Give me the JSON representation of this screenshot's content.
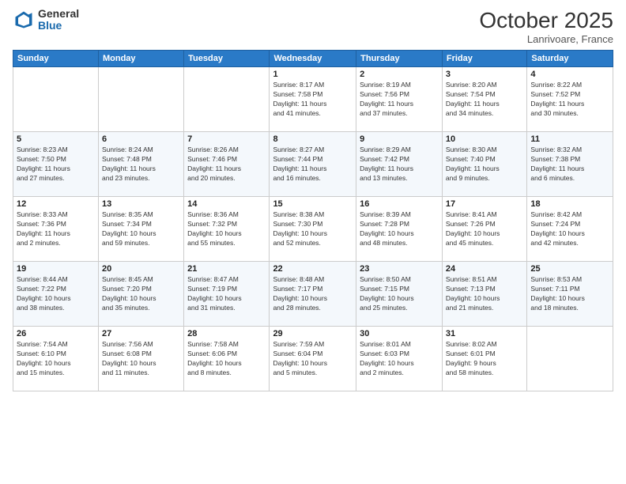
{
  "header": {
    "logo": {
      "general": "General",
      "blue": "Blue"
    },
    "title": "October 2025",
    "location": "Lanrivoare, France"
  },
  "weekdays": [
    "Sunday",
    "Monday",
    "Tuesday",
    "Wednesday",
    "Thursday",
    "Friday",
    "Saturday"
  ],
  "weeks": [
    [
      {
        "day": "",
        "info": ""
      },
      {
        "day": "",
        "info": ""
      },
      {
        "day": "",
        "info": ""
      },
      {
        "day": "1",
        "info": "Sunrise: 8:17 AM\nSunset: 7:58 PM\nDaylight: 11 hours\nand 41 minutes."
      },
      {
        "day": "2",
        "info": "Sunrise: 8:19 AM\nSunset: 7:56 PM\nDaylight: 11 hours\nand 37 minutes."
      },
      {
        "day": "3",
        "info": "Sunrise: 8:20 AM\nSunset: 7:54 PM\nDaylight: 11 hours\nand 34 minutes."
      },
      {
        "day": "4",
        "info": "Sunrise: 8:22 AM\nSunset: 7:52 PM\nDaylight: 11 hours\nand 30 minutes."
      }
    ],
    [
      {
        "day": "5",
        "info": "Sunrise: 8:23 AM\nSunset: 7:50 PM\nDaylight: 11 hours\nand 27 minutes."
      },
      {
        "day": "6",
        "info": "Sunrise: 8:24 AM\nSunset: 7:48 PM\nDaylight: 11 hours\nand 23 minutes."
      },
      {
        "day": "7",
        "info": "Sunrise: 8:26 AM\nSunset: 7:46 PM\nDaylight: 11 hours\nand 20 minutes."
      },
      {
        "day": "8",
        "info": "Sunrise: 8:27 AM\nSunset: 7:44 PM\nDaylight: 11 hours\nand 16 minutes."
      },
      {
        "day": "9",
        "info": "Sunrise: 8:29 AM\nSunset: 7:42 PM\nDaylight: 11 hours\nand 13 minutes."
      },
      {
        "day": "10",
        "info": "Sunrise: 8:30 AM\nSunset: 7:40 PM\nDaylight: 11 hours\nand 9 minutes."
      },
      {
        "day": "11",
        "info": "Sunrise: 8:32 AM\nSunset: 7:38 PM\nDaylight: 11 hours\nand 6 minutes."
      }
    ],
    [
      {
        "day": "12",
        "info": "Sunrise: 8:33 AM\nSunset: 7:36 PM\nDaylight: 11 hours\nand 2 minutes."
      },
      {
        "day": "13",
        "info": "Sunrise: 8:35 AM\nSunset: 7:34 PM\nDaylight: 10 hours\nand 59 minutes."
      },
      {
        "day": "14",
        "info": "Sunrise: 8:36 AM\nSunset: 7:32 PM\nDaylight: 10 hours\nand 55 minutes."
      },
      {
        "day": "15",
        "info": "Sunrise: 8:38 AM\nSunset: 7:30 PM\nDaylight: 10 hours\nand 52 minutes."
      },
      {
        "day": "16",
        "info": "Sunrise: 8:39 AM\nSunset: 7:28 PM\nDaylight: 10 hours\nand 48 minutes."
      },
      {
        "day": "17",
        "info": "Sunrise: 8:41 AM\nSunset: 7:26 PM\nDaylight: 10 hours\nand 45 minutes."
      },
      {
        "day": "18",
        "info": "Sunrise: 8:42 AM\nSunset: 7:24 PM\nDaylight: 10 hours\nand 42 minutes."
      }
    ],
    [
      {
        "day": "19",
        "info": "Sunrise: 8:44 AM\nSunset: 7:22 PM\nDaylight: 10 hours\nand 38 minutes."
      },
      {
        "day": "20",
        "info": "Sunrise: 8:45 AM\nSunset: 7:20 PM\nDaylight: 10 hours\nand 35 minutes."
      },
      {
        "day": "21",
        "info": "Sunrise: 8:47 AM\nSunset: 7:19 PM\nDaylight: 10 hours\nand 31 minutes."
      },
      {
        "day": "22",
        "info": "Sunrise: 8:48 AM\nSunset: 7:17 PM\nDaylight: 10 hours\nand 28 minutes."
      },
      {
        "day": "23",
        "info": "Sunrise: 8:50 AM\nSunset: 7:15 PM\nDaylight: 10 hours\nand 25 minutes."
      },
      {
        "day": "24",
        "info": "Sunrise: 8:51 AM\nSunset: 7:13 PM\nDaylight: 10 hours\nand 21 minutes."
      },
      {
        "day": "25",
        "info": "Sunrise: 8:53 AM\nSunset: 7:11 PM\nDaylight: 10 hours\nand 18 minutes."
      }
    ],
    [
      {
        "day": "26",
        "info": "Sunrise: 7:54 AM\nSunset: 6:10 PM\nDaylight: 10 hours\nand 15 minutes."
      },
      {
        "day": "27",
        "info": "Sunrise: 7:56 AM\nSunset: 6:08 PM\nDaylight: 10 hours\nand 11 minutes."
      },
      {
        "day": "28",
        "info": "Sunrise: 7:58 AM\nSunset: 6:06 PM\nDaylight: 10 hours\nand 8 minutes."
      },
      {
        "day": "29",
        "info": "Sunrise: 7:59 AM\nSunset: 6:04 PM\nDaylight: 10 hours\nand 5 minutes."
      },
      {
        "day": "30",
        "info": "Sunrise: 8:01 AM\nSunset: 6:03 PM\nDaylight: 10 hours\nand 2 minutes."
      },
      {
        "day": "31",
        "info": "Sunrise: 8:02 AM\nSunset: 6:01 PM\nDaylight: 9 hours\nand 58 minutes."
      },
      {
        "day": "",
        "info": ""
      }
    ]
  ]
}
